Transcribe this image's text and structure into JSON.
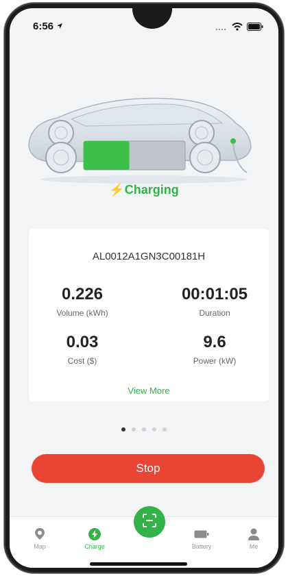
{
  "status_bar": {
    "time": "6:56"
  },
  "hero": {
    "status_text": "Charging",
    "battery_fill": 0.45
  },
  "charger": {
    "id": "AL0012A1GN3C00181H"
  },
  "metrics": {
    "volume": {
      "value": "0.226",
      "label": "Volume (kWh)"
    },
    "duration": {
      "value": "00:01:05",
      "label": "Duration"
    },
    "cost": {
      "value": "0.03",
      "label": "Cost ($)"
    },
    "power": {
      "value": "9.6",
      "label": "Power (kW)"
    }
  },
  "view_more": "View More",
  "pagination": {
    "count": 5,
    "active": 1
  },
  "actions": {
    "stop": "Stop"
  },
  "tabs": [
    {
      "label": "Map",
      "icon": "map-pin-icon"
    },
    {
      "label": "Charge",
      "icon": "lightning-icon",
      "active": true
    },
    {
      "label": "",
      "icon": "scan-icon"
    },
    {
      "label": "Battery",
      "icon": "battery-icon"
    },
    {
      "label": "Me",
      "icon": "user-icon"
    }
  ],
  "colors": {
    "accent": "#34b24a",
    "stop": "#e94535"
  }
}
